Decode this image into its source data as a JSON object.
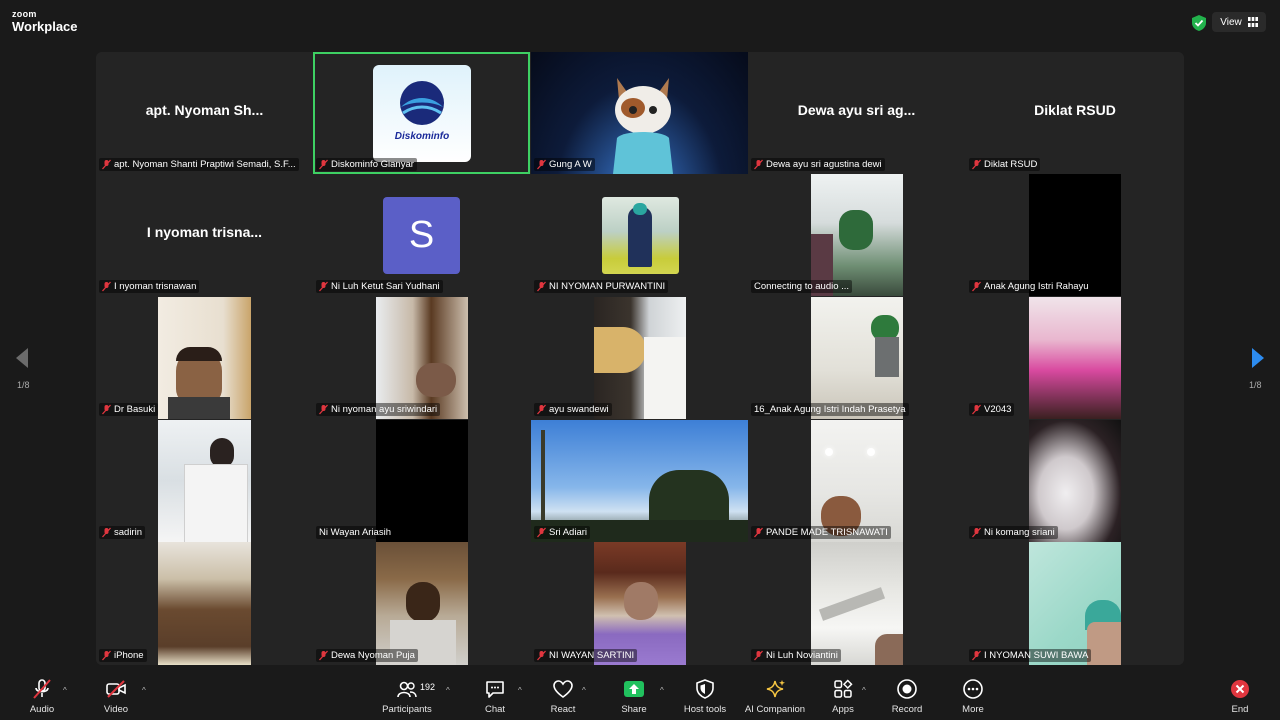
{
  "app": {
    "logo_top": "zoom",
    "logo_bottom": "Workplace",
    "view_label": "View",
    "accent_green": "#3ed063"
  },
  "pagination": {
    "left_label": "1/8",
    "right_label": "1/8"
  },
  "tiles": [
    {
      "name": "apt. Nyoman Shanti Praptiwi Semadi, S.F...",
      "big": "apt. Nyoman Sh...",
      "muted": true
    },
    {
      "name": "Diskominfo Gianyar",
      "muted": true,
      "active": true,
      "logo": "Diskominfo"
    },
    {
      "name": "Gung A W",
      "muted": true
    },
    {
      "name": "Dewa ayu sri agustina dewi",
      "big": "Dewa ayu sri ag...",
      "muted": true
    },
    {
      "name": "Diklat RSUD",
      "big": "Diklat RSUD",
      "muted": true
    },
    {
      "name": "I nyoman trisnawan",
      "big": "I nyoman trisna...",
      "muted": true
    },
    {
      "name": "Ni Luh Ketut Sari Yudhani",
      "muted": true,
      "avatar": "S"
    },
    {
      "name": "NI NYOMAN PURWANTINI",
      "muted": true
    },
    {
      "name": "Connecting to audio ...",
      "muted": false
    },
    {
      "name": "Anak Agung Istri Rahayu",
      "muted": true
    },
    {
      "name": "Dr Basuki",
      "muted": true
    },
    {
      "name": "Ni nyoman ayu sriwindari",
      "muted": true
    },
    {
      "name": "ayu swandewi",
      "muted": true
    },
    {
      "name": "16_Anak Agung Istri Indah Prasetya",
      "muted": false
    },
    {
      "name": "V2043",
      "muted": true
    },
    {
      "name": "sadirin",
      "muted": true
    },
    {
      "name": "Ni Wayan Ariasih",
      "muted": false
    },
    {
      "name": "Sri Adiari",
      "muted": true
    },
    {
      "name": "PANDE MADE TRISNAWATI",
      "muted": true
    },
    {
      "name": "Ni komang sriani",
      "muted": true
    },
    {
      "name": "iPhone",
      "muted": true
    },
    {
      "name": "Dewa Nyoman Puja",
      "muted": true
    },
    {
      "name": "NI WAYAN SARTINI",
      "muted": true
    },
    {
      "name": "Ni Luh Noviantini",
      "muted": true
    },
    {
      "name": "I NYOMAN SUWI BAWA",
      "muted": true
    }
  ],
  "toolbar": {
    "audio": "Audio",
    "video": "Video",
    "participants": "Participants",
    "participants_count": "192",
    "chat": "Chat",
    "react": "React",
    "share": "Share",
    "host_tools": "Host tools",
    "ai_companion": "AI Companion",
    "apps": "Apps",
    "record": "Record",
    "more": "More",
    "end": "End"
  }
}
